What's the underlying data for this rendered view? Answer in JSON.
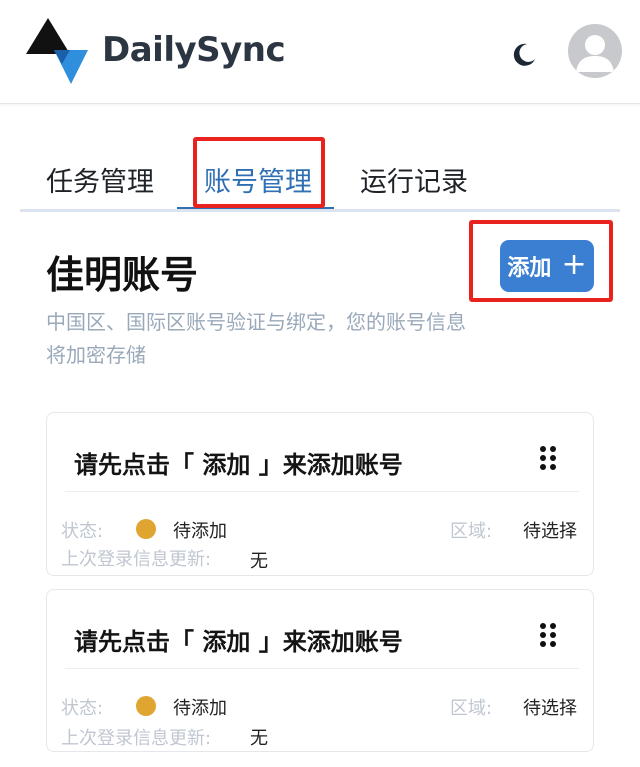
{
  "header": {
    "brand": "DailySync",
    "icons": {
      "theme": "moon-icon",
      "avatar": "user-avatar-icon"
    }
  },
  "tabs": [
    {
      "label": "任务管理",
      "active": false
    },
    {
      "label": "账号管理",
      "active": true
    },
    {
      "label": "运行记录",
      "active": false
    }
  ],
  "section": {
    "title": "佳明账号",
    "description": "中国区、国际区账号验证与绑定，您的账号信息将加密存储",
    "add_button": {
      "label": "添加",
      "icon": "plus-icon"
    }
  },
  "accounts": [
    {
      "title": "请先点击「 添加 」来添加账号",
      "status_label": "状态:",
      "status_value": "待添加",
      "region_label": "区域:",
      "region_value": "待选择",
      "last_login_label": "上次登录信息更新:",
      "last_login_value": "无"
    },
    {
      "title": "请先点击「 添加 」来添加账号",
      "status_label": "状态:",
      "status_value": "待添加",
      "region_label": "区域:",
      "region_value": "待选择",
      "last_login_label": "上次登录信息更新:",
      "last_login_value": "无"
    }
  ],
  "colors": {
    "accent": "#2f6fb3",
    "button": "#3a7fd1",
    "status_pending": "#e0a531",
    "highlight": "#e8231f",
    "muted_text": "#9aa9ba"
  }
}
